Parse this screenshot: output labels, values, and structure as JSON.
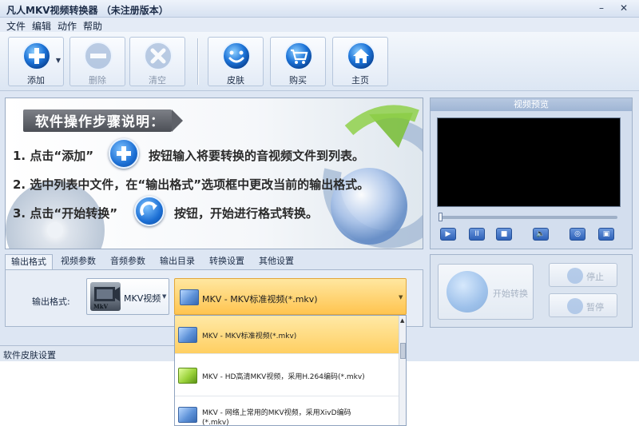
{
  "window": {
    "title": "凡人MKV视频转换器 （未注册版本）",
    "min_glyph": "–",
    "close_glyph": "✕"
  },
  "menu": [
    "文件",
    "编辑",
    "动作",
    "帮助"
  ],
  "toolbar": {
    "buttons": [
      {
        "label": "添加",
        "icon": "add-icon",
        "enabled": true
      },
      {
        "label": "删除",
        "icon": "minus-icon",
        "enabled": false
      },
      {
        "label": "清空",
        "icon": "clear-icon",
        "enabled": false
      },
      {
        "label": "皮肤",
        "icon": "smiley-icon",
        "enabled": true
      },
      {
        "label": "购买",
        "icon": "cart-icon",
        "enabled": true
      },
      {
        "label": "主页",
        "icon": "home-icon",
        "enabled": true
      }
    ],
    "dropdown_glyph": "▼"
  },
  "instructions": {
    "title": "软件操作步骤说明：",
    "step1_before": "1. 点击“添加”",
    "step1_after": "按钮输入将要转换的音视频文件到列表。",
    "step2": "2. 选中列表中文件，在“输出格式”选项框中更改当前的输出格式。",
    "step3_before": "3. 点击“开始转换”",
    "step3_after": "按钮，开始进行格式转换。"
  },
  "preview": {
    "title": "视频预览",
    "controls": [
      "▶",
      "II",
      "■",
      "🔈",
      "◎",
      "▣"
    ],
    "colors": {
      "screen": "#000000",
      "accent": "#2e61b8"
    }
  },
  "tabs": [
    "输出格式",
    "视频参数",
    "音频参数",
    "输出目录",
    "转换设置",
    "其他设置"
  ],
  "output": {
    "label": "输出格式:",
    "category": "MKV视频",
    "category_icon_text": "MkV",
    "selected": "MKV - MKV标准视频(*.mkv)",
    "arrow_glyph": "▼"
  },
  "dropdown_items": [
    {
      "line1": "MKV - MKV标准视频(*.mkv)",
      "line2": "",
      "color": "blue",
      "selected": true
    },
    {
      "line1": "MKV - HD高清MKV视频，采用H.264编码(*.mkv)",
      "line2": "",
      "color": "green",
      "selected": false
    },
    {
      "line1": "MKV - 网络上常用的MKV视频，采用XivD编码",
      "line2": "(*.mkv)",
      "color": "blue",
      "selected": false
    }
  ],
  "actions": {
    "start": "开始转换",
    "stop": "停止",
    "pause": "暂停"
  },
  "status": {
    "text": "软件皮肤设置"
  }
}
